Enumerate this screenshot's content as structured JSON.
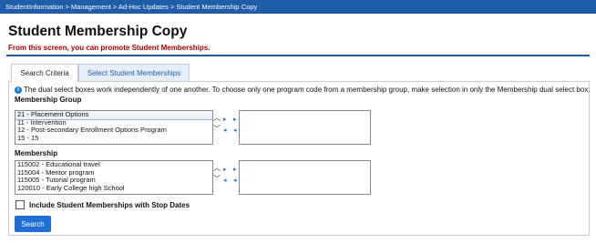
{
  "breadcrumb": "StudentInformation > Management > Ad-Hoc Updates > Student Membership Copy",
  "page": {
    "title": "Student Membership Copy",
    "subtitle": "From this screen, you can promote Student Memberships."
  },
  "tabs": [
    {
      "label": "Search Criteria",
      "active": true
    },
    {
      "label": "Select Student Memberships",
      "active": false
    }
  ],
  "info_text": "The dual select boxes work independently of one another. To choose only one program code from a membership group, make selection in only the Membership dual select box.",
  "membership_group": {
    "label": "Membership Group",
    "available": [
      "21 - Placement Options",
      "11 - Intervention",
      "12 - Post-secondary Enrollment Options Program",
      "15 - 15"
    ],
    "selected": []
  },
  "membership": {
    "label": "Membership",
    "available": [
      "115002 - Educational travel",
      "115004 - Mentor program",
      "115005 - Tutorial program",
      "120010 - Early College high School"
    ],
    "selected": []
  },
  "checkbox": {
    "label": "Include Student Memberships with Stop Dates",
    "checked": false
  },
  "search_button": "Search",
  "colors": {
    "header_bar": "#1f5da8",
    "subtitle": "#a00000",
    "accent": "#1f6fd6"
  }
}
